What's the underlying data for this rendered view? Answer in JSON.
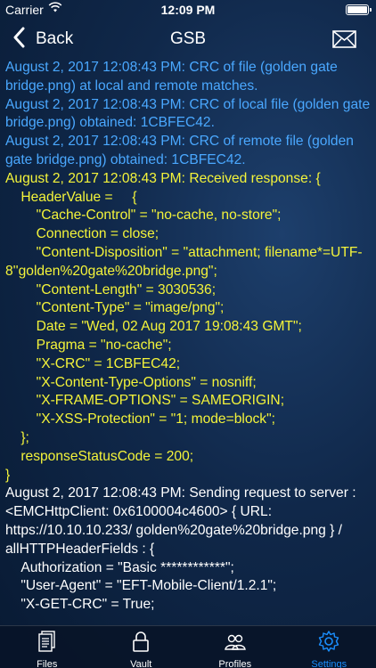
{
  "status_bar": {
    "carrier": "Carrier",
    "time": "12:09 PM"
  },
  "nav": {
    "back_label": "Back",
    "title": "GSB"
  },
  "log_lines": [
    {
      "text": "August 2, 2017 12:08:43 PM: CRC of file (golden gate bridge.png) at local and remote matches.",
      "style": "info"
    },
    {
      "text": "August 2, 2017 12:08:43 PM: CRC of local file (golden gate bridge.png) obtained: 1CBFEC42.",
      "style": "info"
    },
    {
      "text": "August 2, 2017 12:08:43 PM: CRC of remote file (golden gate bridge.png) obtained: 1CBFEC42.",
      "style": "info"
    },
    {
      "text": "August 2, 2017 12:08:43 PM: Received response: {",
      "style": "resp"
    },
    {
      "text": "    HeaderValue =     {",
      "style": "resp"
    },
    {
      "text": "        \"Cache-Control\" = \"no-cache, no-store\";",
      "style": "resp"
    },
    {
      "text": "        Connection = close;",
      "style": "resp"
    },
    {
      "text": "        \"Content-Disposition\" = \"attachment; filename*=UTF-8''golden%20gate%20bridge.png\";",
      "style": "resp"
    },
    {
      "text": "        \"Content-Length\" = 3030536;",
      "style": "resp"
    },
    {
      "text": "        \"Content-Type\" = \"image/png\";",
      "style": "resp"
    },
    {
      "text": "        Date = \"Wed, 02 Aug 2017 19:08:43 GMT\";",
      "style": "resp"
    },
    {
      "text": "        Pragma = \"no-cache\";",
      "style": "resp"
    },
    {
      "text": "        \"X-CRC\" = 1CBFEC42;",
      "style": "resp"
    },
    {
      "text": "        \"X-Content-Type-Options\" = nosniff;",
      "style": "resp"
    },
    {
      "text": "        \"X-FRAME-OPTIONS\" = SAMEORIGIN;",
      "style": "resp"
    },
    {
      "text": "        \"X-XSS-Protection\" = \"1; mode=block\";",
      "style": "resp"
    },
    {
      "text": "    };",
      "style": "resp"
    },
    {
      "text": "    responseStatusCode = 200;",
      "style": "resp"
    },
    {
      "text": "}",
      "style": "resp"
    },
    {
      "text": "August 2, 2017 12:08:43 PM: Sending request to server : <EMCHttpClient: 0x6100004c4600> { URL: https://10.10.10.233/ golden%20gate%20bridge.png } / allHTTPHeaderFields : {",
      "style": "req"
    },
    {
      "text": "    Authorization = \"Basic ************\";",
      "style": "req"
    },
    {
      "text": "    \"User-Agent\" = \"EFT-Mobile-Client/1.2.1\";",
      "style": "req"
    },
    {
      "text": "    \"X-GET-CRC\" = True;",
      "style": "req"
    }
  ],
  "tabs": [
    {
      "label": "Files",
      "icon": "files-icon",
      "active": false
    },
    {
      "label": "Vault",
      "icon": "lock-icon",
      "active": false
    },
    {
      "label": "Profiles",
      "icon": "profiles-icon",
      "active": false
    },
    {
      "label": "Settings",
      "icon": "gear-icon",
      "active": true
    }
  ],
  "colors": {
    "info": "#4aa8ff",
    "response": "#f4f43a",
    "request": "#ffffff",
    "active_tab": "#1a8fff"
  }
}
